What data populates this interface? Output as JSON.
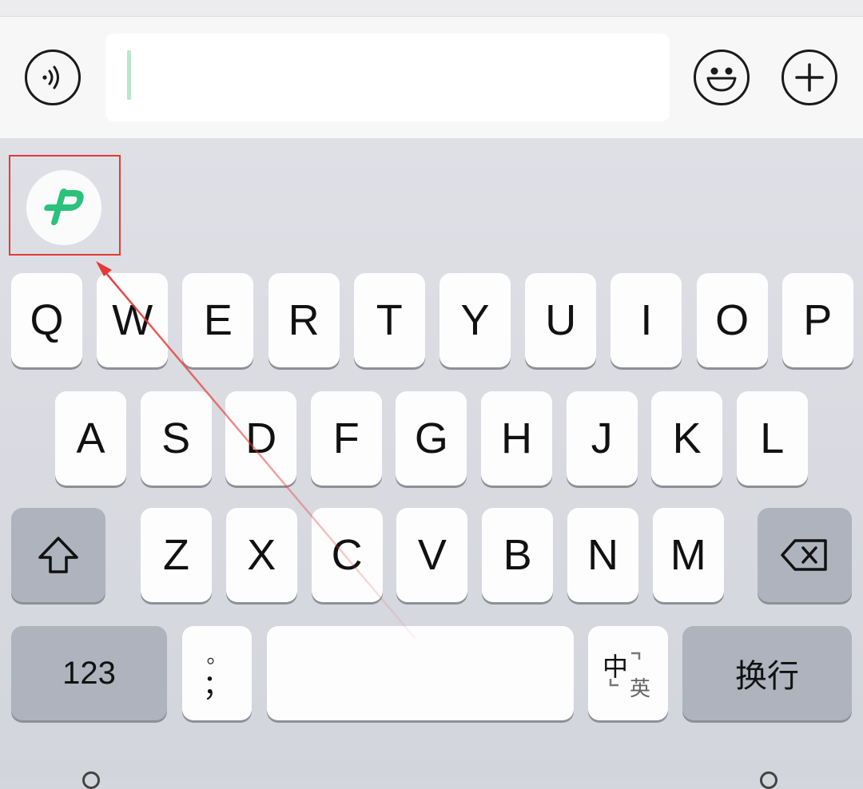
{
  "input_bar": {
    "voice_icon": "voice-wave-icon",
    "emoji_icon": "smiley-icon",
    "plus_icon": "plus-icon",
    "text_value": ""
  },
  "suggestion": {
    "app_icon": "p-logo-icon",
    "brand_color": "#2bc27a",
    "highlight_color": "#e53935"
  },
  "keyboard": {
    "row1": [
      "Q",
      "W",
      "E",
      "R",
      "T",
      "Y",
      "U",
      "I",
      "O",
      "P"
    ],
    "row2": [
      "A",
      "S",
      "D",
      "F",
      "G",
      "H",
      "J",
      "K",
      "L"
    ],
    "row3": [
      "Z",
      "X",
      "C",
      "V",
      "B",
      "N",
      "M"
    ],
    "shift_icon": "shift-arrow-icon",
    "backspace_icon": "backspace-icon",
    "numbers_label": "123",
    "punct_top": "。",
    "punct_bottom": "；",
    "lang_switch_main": "中",
    "lang_switch_sub": "英",
    "return_label": "换行"
  }
}
